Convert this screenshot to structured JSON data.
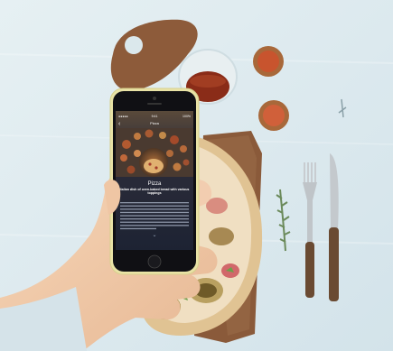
{
  "photo": {
    "colors": {
      "table": "#dbe9ee",
      "table_light": "#e7f0f3",
      "board": "#8a5a3a",
      "pizza_crust": "#e2c797",
      "pizza_top": "#efdcbc",
      "fig": "#a85a3a",
      "phone_body": "#e8e0a8",
      "skin": "#f0c9a8",
      "sleeve": "#d9e5ea"
    },
    "icons": [
      "fork-icon",
      "knife-icon",
      "rosemary-icon",
      "wine-glass-icon",
      "fig-icon"
    ]
  },
  "phone": {
    "status_bar": {
      "carrier": "●●●●●",
      "time": "9:41",
      "battery": "100%"
    },
    "nav": {
      "back": "‹",
      "title_small": "Pizza"
    },
    "screen": {
      "title": "Pizza",
      "subtitle": "Italian dish of oven-baked bread with various toppings",
      "body_lines": 9,
      "scroll_hint": "⌄"
    }
  }
}
